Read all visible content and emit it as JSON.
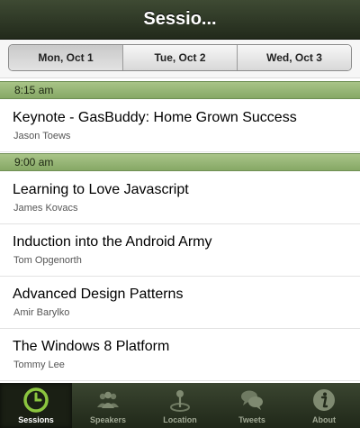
{
  "title": "Sessio...",
  "days": [
    {
      "label": "Mon, Oct 1",
      "active": true
    },
    {
      "label": "Tue, Oct 2",
      "active": false
    },
    {
      "label": "Wed, Oct 3",
      "active": false
    }
  ],
  "sections": [
    {
      "time": "8:15 am",
      "sessions": [
        {
          "title": "Keynote - GasBuddy: Home Grown Success",
          "speaker": "Jason Toews"
        }
      ]
    },
    {
      "time": "9:00 am",
      "sessions": [
        {
          "title": "Learning to Love Javascript",
          "speaker": "James Kovacs"
        },
        {
          "title": "Induction into the Android Army",
          "speaker": "Tom Opgenorth"
        },
        {
          "title": "Advanced Design Patterns",
          "speaker": "Amir Barylko"
        },
        {
          "title": "The Windows 8 Platform",
          "speaker": "Tommy Lee"
        }
      ]
    }
  ],
  "tabs": [
    {
      "label": "Sessions",
      "icon": "clock-icon",
      "active": true
    },
    {
      "label": "Speakers",
      "icon": "people-icon",
      "active": false
    },
    {
      "label": "Location",
      "icon": "map-pin-icon",
      "active": false
    },
    {
      "label": "Tweets",
      "icon": "speech-bubbles-icon",
      "active": false
    },
    {
      "label": "About",
      "icon": "info-icon",
      "active": false
    }
  ],
  "colors": {
    "accent": "#8bc53f",
    "header_band": "#96b474",
    "titlebar": "#2e3826"
  }
}
